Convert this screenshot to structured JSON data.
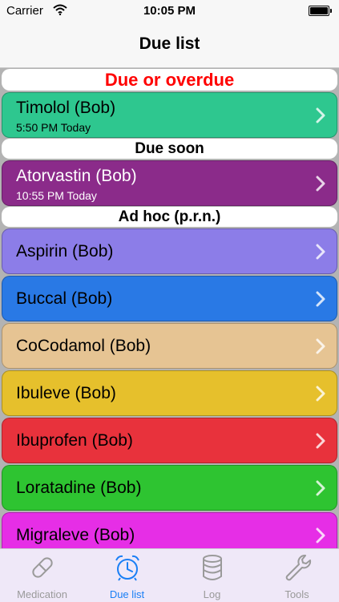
{
  "status_bar": {
    "carrier": "Carrier",
    "time": "10:05 PM"
  },
  "nav": {
    "title": "Due list"
  },
  "sections": [
    {
      "header": "Due or overdue",
      "header_color": "#ff0000"
    },
    {
      "header": "Due soon",
      "header_color": "#000000"
    },
    {
      "header": "Ad hoc (p.r.n.)",
      "header_color": "#000000"
    }
  ],
  "overdue_items": [
    {
      "name": "Timolol (Bob)",
      "time": "5:50 PM Today",
      "color": "#2ec78f",
      "text_color": "#000000"
    }
  ],
  "soon_items": [
    {
      "name": "Atorvastin (Bob)",
      "time": "10:55 PM Today",
      "color": "#8b2b8a",
      "text_color": "#ffffff"
    }
  ],
  "adhoc_items": [
    {
      "name": "Aspirin (Bob)",
      "color": "#8c7de8",
      "text_color": "#000000"
    },
    {
      "name": "Buccal (Bob)",
      "color": "#2979e5",
      "text_color": "#000000"
    },
    {
      "name": "CoCodamol (Bob)",
      "color": "#e6c493",
      "text_color": "#000000"
    },
    {
      "name": "Ibuleve (Bob)",
      "color": "#e6c02c",
      "text_color": "#000000"
    },
    {
      "name": "Ibuprofen (Bob)",
      "color": "#e8323c",
      "text_color": "#000000"
    },
    {
      "name": "Loratadine (Bob)",
      "color": "#2ec431",
      "text_color": "#000000"
    },
    {
      "name": "Migraleve (Bob)",
      "color": "#e62ee6",
      "text_color": "#000000"
    }
  ],
  "tabs": [
    {
      "label": "Medication",
      "icon": "pill-icon",
      "active": false
    },
    {
      "label": "Due list",
      "icon": "alarm-clock-icon",
      "active": true
    },
    {
      "label": "Log",
      "icon": "database-icon",
      "active": false
    },
    {
      "label": "Tools",
      "icon": "wrench-icon",
      "active": false
    }
  ],
  "colors": {
    "active_tab": "#1a7ff5",
    "inactive_tab": "#9a9a9a"
  }
}
